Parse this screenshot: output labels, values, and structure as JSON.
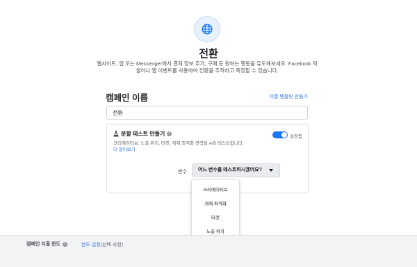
{
  "header": {
    "icon": "globe-icon",
    "title": "전환",
    "description_line1": "웹사이트, 앱 또는 Messenger에서 결제 정보 추가, 구매 등 원하는 행동을 유도해보세요.",
    "description_line2": "Facebook 픽셀이나 앱 이벤트를 사용하여 전환을 추적하고 측정할 수 있습니다."
  },
  "campaign_name": {
    "section_title": "캠페인 이름",
    "template_link": "이름 템플릿 만들기",
    "value": "전환"
  },
  "ab_test": {
    "icon": "flask-icon",
    "title": "분할 테스트 만들기",
    "info_icon": "info-icon",
    "description": "크리에이티브, 노출 위치, 타겟, 게재 최적화 전략을 A/B 테스트합니다.",
    "learn_more": "더 알아보기",
    "toggle_label": "설정됨",
    "toggle_on": true,
    "accent_color": "#1877f2"
  },
  "variable": {
    "label": "변수",
    "select_placeholder": "어느 변수를 테스트하시겠어요?",
    "options": [
      "크리에이티브",
      "게재 최적화",
      "타겟",
      "노출 위치"
    ]
  },
  "footer": {
    "label": "캠페인 지출 한도",
    "info_icon": "info-icon",
    "link": "한도 설정",
    "optional": "(선택 사항)"
  }
}
